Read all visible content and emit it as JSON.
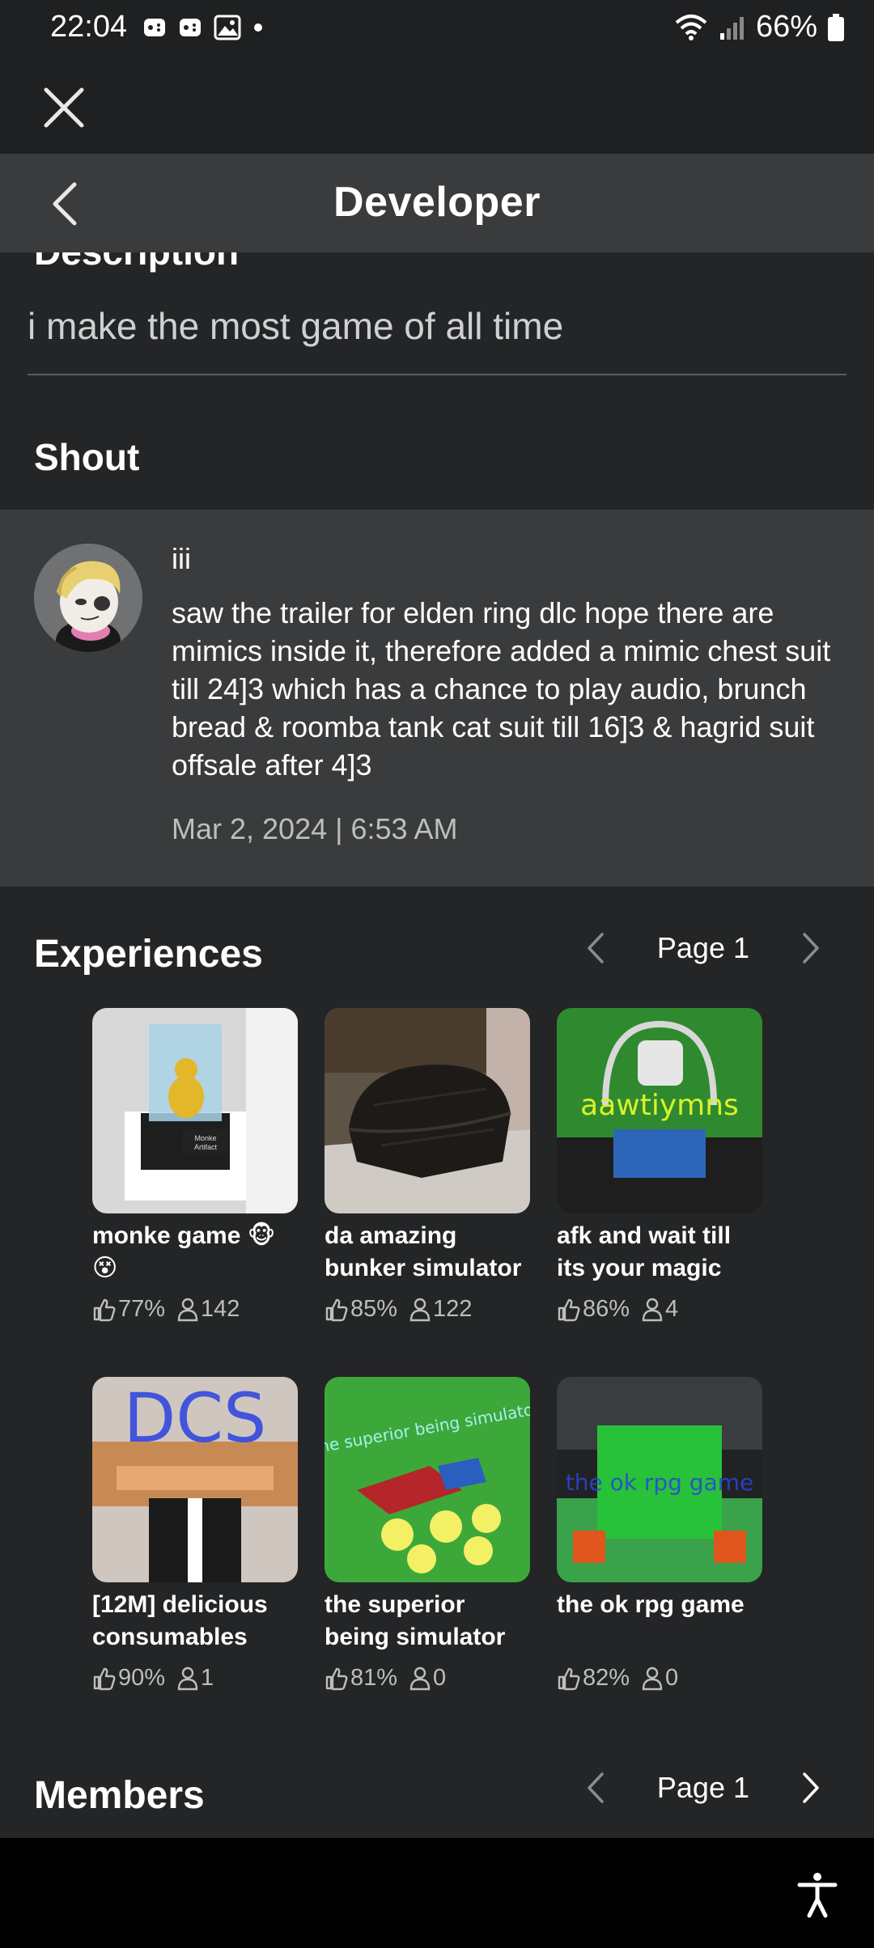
{
  "status_bar": {
    "time": "22:04",
    "battery": "66%"
  },
  "header": {
    "title": "Developer"
  },
  "description": {
    "heading": "Description",
    "text": "i make the most game of all time"
  },
  "shout": {
    "heading": "Shout",
    "user": "iii",
    "body": "saw the trailer for elden ring dlc hope there are mimics inside it, therefore added a mimic chest suit till 24]3 which has a chance to play audio, brunch bread & roomba tank cat suit till 16]3 & hagrid suit offsale after 4]3",
    "date": "Mar 2, 2024 | 6:53 AM"
  },
  "experiences": {
    "heading": "Experiences",
    "page_label": "Page 1",
    "games": [
      {
        "title": "monke game 🐵😵",
        "rating": "77%",
        "players": "142",
        "thumb": "museum"
      },
      {
        "title": "da amazing bunker simulator",
        "rating": "85%",
        "players": "122",
        "thumb": "chest"
      },
      {
        "title": "afk and wait till its your magic",
        "rating": "86%",
        "players": "4",
        "thumb": "afk",
        "thumb_text": "aawtiymns"
      },
      {
        "title": "[12M] delicious consumables",
        "rating": "90%",
        "players": "1",
        "thumb": "dcs",
        "thumb_text": "DCS"
      },
      {
        "title": "the superior being simulator",
        "rating": "81%",
        "players": "0",
        "thumb": "superior",
        "thumb_text": "the superior being simulator"
      },
      {
        "title": "the ok rpg game",
        "rating": "82%",
        "players": "0",
        "thumb": "okrpg",
        "thumb_text": "the ok rpg game"
      }
    ]
  },
  "members": {
    "heading": "Members",
    "page_label": "Page 1"
  },
  "colors": {
    "background": "#232527",
    "panel": "#393b3d",
    "text": "#ffffff",
    "muted": "#bdbebe"
  }
}
